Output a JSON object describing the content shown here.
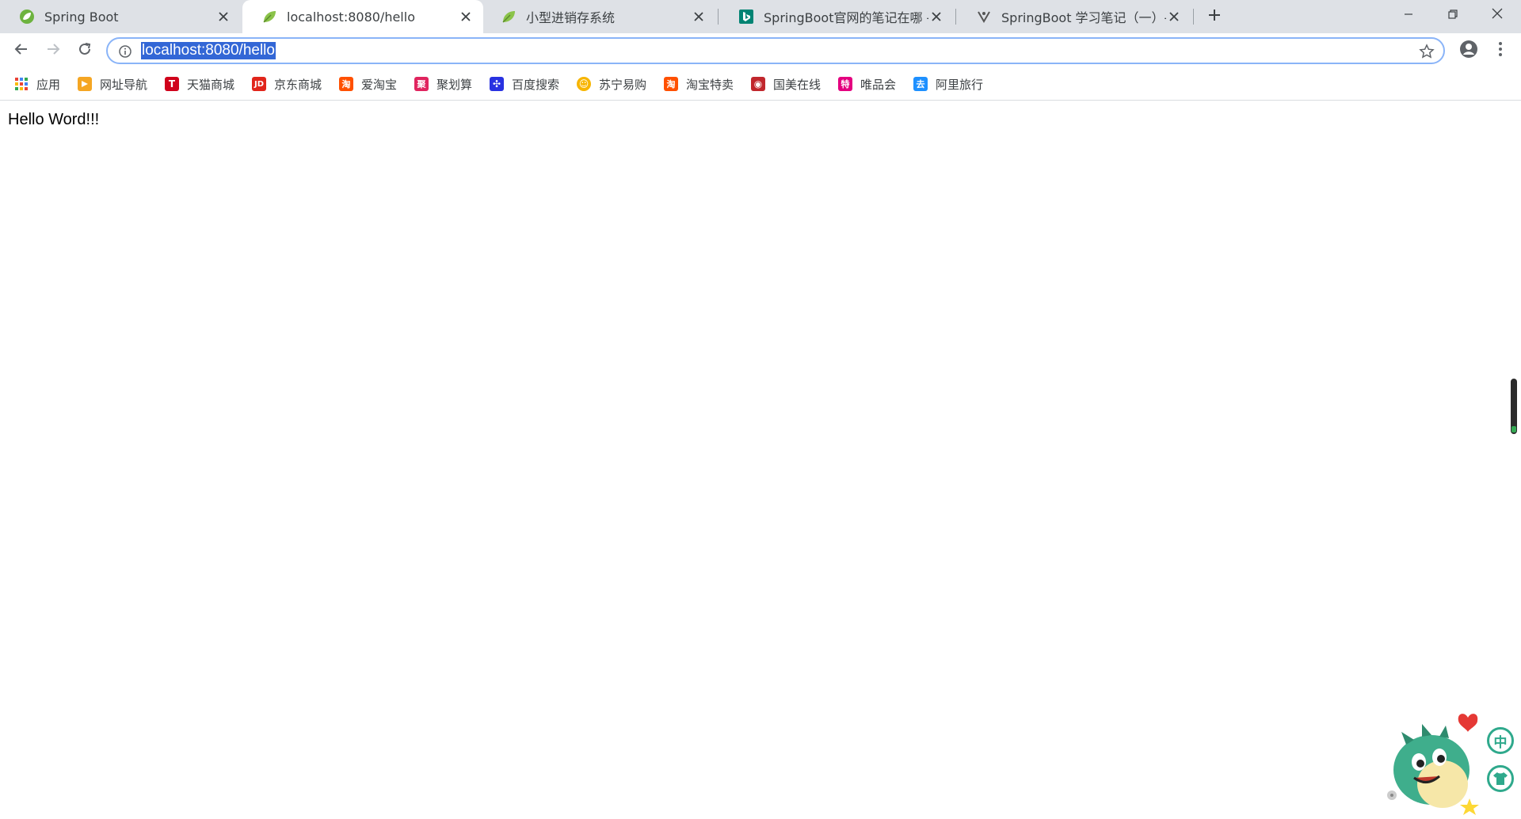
{
  "browser": {
    "tabs": [
      {
        "title": "Spring Boot",
        "icon": "spring-leaf-icon",
        "active": false
      },
      {
        "title": "localhost:8080/hello",
        "icon": "spring-leaf-icon",
        "active": true
      },
      {
        "title": "小型进销存系统",
        "icon": "spring-leaf-icon",
        "active": false
      },
      {
        "title": "SpringBoot官网的笔记在哪 - 国",
        "icon": "bing-icon",
        "active": false
      },
      {
        "title": "SpringBoot 学习笔记（一）- 优",
        "icon": "site-logo-icon",
        "active": false
      }
    ],
    "new_tab_icon": "plus-icon",
    "window_controls": [
      "minimize-icon",
      "restore-icon",
      "close-icon"
    ]
  },
  "toolbar": {
    "back_icon": "back-arrow-icon",
    "forward_icon": "forward-arrow-icon",
    "reload_icon": "reload-icon",
    "url": "localhost:8080/hello",
    "info_icon": "info-icon",
    "bookmark_star_icon": "star-icon",
    "profile_icon": "account-circle-icon",
    "menu_icon": "kebab-menu-icon"
  },
  "bookmarks": [
    {
      "label": "应用",
      "icon": "apps-grid-icon",
      "color": "#4285f4"
    },
    {
      "label": "网址导航",
      "icon": "nav-icon",
      "color": "#f5a623"
    },
    {
      "label": "天猫商城",
      "icon": "tmall-icon",
      "color": "#d0021b",
      "glyph": "T"
    },
    {
      "label": "京东商城",
      "icon": "jd-icon",
      "color": "#e1251b",
      "glyph": "JD"
    },
    {
      "label": "爱淘宝",
      "icon": "taobao-icon",
      "color": "#ff5000",
      "glyph": "淘"
    },
    {
      "label": "聚划算",
      "icon": "juhuasuan-icon",
      "color": "#e0245e",
      "glyph": "聚"
    },
    {
      "label": "百度搜索",
      "icon": "baidu-icon",
      "color": "#2932e1",
      "glyph": "✣"
    },
    {
      "label": "苏宁易购",
      "icon": "suning-icon",
      "color": "#f7b500",
      "glyph": "☺"
    },
    {
      "label": "淘宝特卖",
      "icon": "taobao-sale-icon",
      "color": "#ff5000",
      "glyph": "淘"
    },
    {
      "label": "国美在线",
      "icon": "gome-icon",
      "color": "#c1272d",
      "glyph": "◉"
    },
    {
      "label": "唯品会",
      "icon": "vip-icon",
      "color": "#e4007f",
      "glyph": "特"
    },
    {
      "label": "阿里旅行",
      "icon": "alitrip-icon",
      "color": "#1e90ff",
      "glyph": "去"
    }
  ],
  "page": {
    "text": "Hello Word!!!"
  },
  "widget": {
    "mascot_icon": "dinosaur-mascot-icon",
    "lang_button": "中",
    "skin_icon": "shirt-icon"
  }
}
